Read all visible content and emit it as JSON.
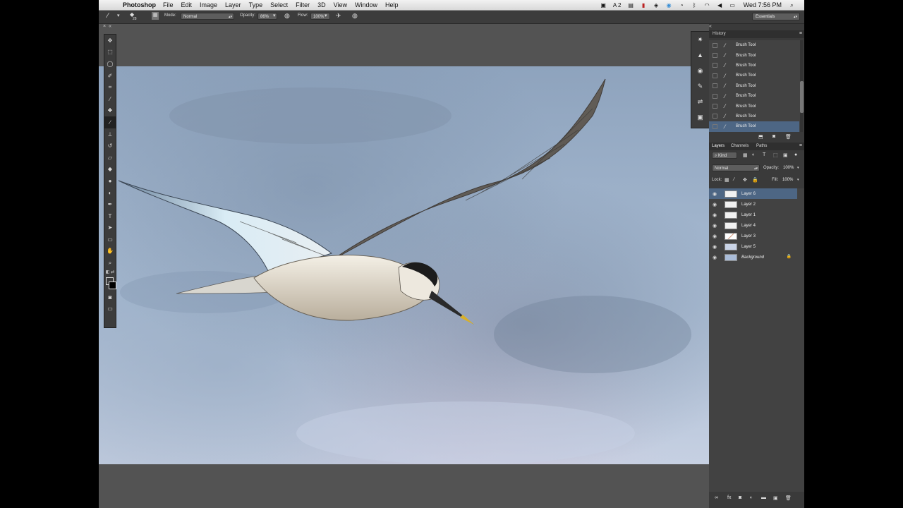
{
  "menubar": {
    "app_name": "Photoshop",
    "items": [
      "File",
      "Edit",
      "Image",
      "Layer",
      "Type",
      "Select",
      "Filter",
      "3D",
      "View",
      "Window",
      "Help"
    ],
    "status_glyph": "A 2",
    "clock": "Wed 7:56 PM"
  },
  "options": {
    "brush_size": "28",
    "mode_label": "Mode:",
    "mode_value": "Normal",
    "opacity_label": "Opacity:",
    "opacity_value": "86%",
    "flow_label": "Flow:",
    "flow_value": "100%",
    "workspace": "Essentials"
  },
  "history": {
    "title": "History",
    "items": [
      "Brush Tool",
      "Brush Tool",
      "Brush Tool",
      "Brush Tool",
      "Brush Tool",
      "Brush Tool",
      "Brush Tool",
      "Brush Tool",
      "Brush Tool"
    ],
    "selected_index": 8
  },
  "layers_panel": {
    "tabs": [
      "Layers",
      "Channels",
      "Paths"
    ],
    "kind_label": "Kind",
    "blend_mode": "Normal",
    "opacity_label": "Opacity:",
    "opacity_value": "100%",
    "lock_label": "Lock:",
    "fill_label": "Fill:",
    "fill_value": "100%",
    "layers": [
      "Layer 6",
      "Layer 2",
      "Layer 1",
      "Layer 4",
      "Layer 3",
      "Layer 5",
      "Background"
    ],
    "selected_index": 0
  },
  "colors": {
    "accent_selection": "#4d6684",
    "panel_bg": "#3a3a3a",
    "canvas_sky": "#a9bcd3"
  }
}
